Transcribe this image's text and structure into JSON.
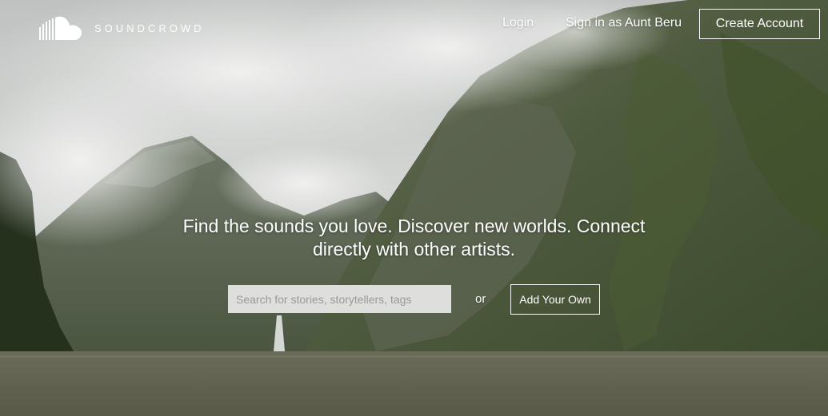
{
  "brand": {
    "name": "SOUNDCROWD",
    "logo_icon": "cloud-logo-icon"
  },
  "nav": {
    "login_label": "Login",
    "sign_in_as_label": "Sign in as Aunt Beru",
    "create_account_label": "Create Account"
  },
  "hero": {
    "tagline": "Find the sounds you love. Discover new worlds. Connect directly with other artists.",
    "background": "fjord-landscape-photo"
  },
  "search": {
    "placeholder": "Search for stories, storytellers, tags",
    "value": ""
  },
  "or_label": "or",
  "add_button_label": "Add Your Own",
  "colors": {
    "text": "#ffffff",
    "search_bg": "#dededd",
    "placeholder": "#9a9a9a"
  }
}
